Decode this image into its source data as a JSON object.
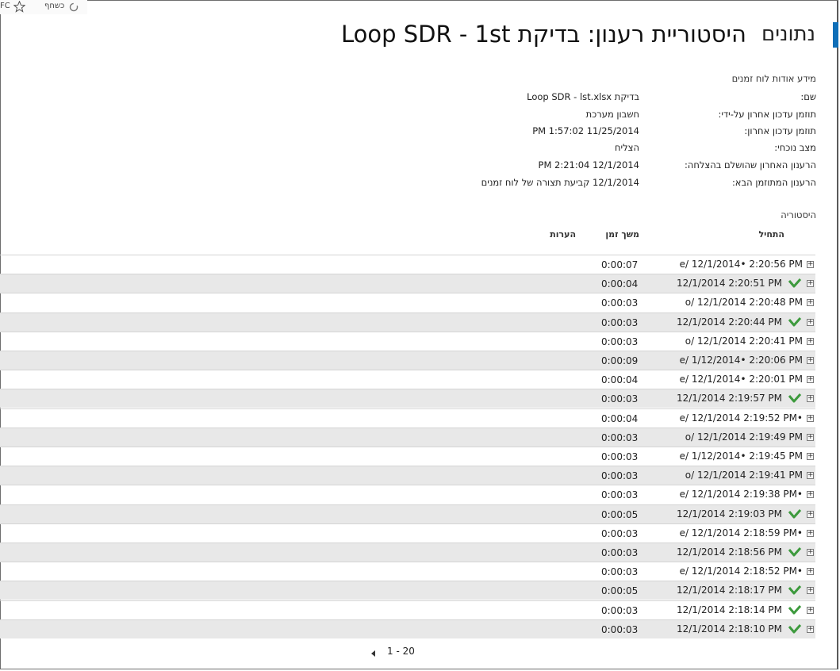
{
  "browser": {
    "share_label": "כשחף",
    "fav_label": "FC"
  },
  "page": {
    "app_title": "נתונים",
    "title": "היסטוריית רענון: בדיקת Loop SDR - 1st"
  },
  "info": {
    "section_title": "מידע אודות לוח זמנים",
    "fields": [
      {
        "label": "שם:",
        "value": "בדיקת Loop SDR - lst.xlsx"
      },
      {
        "label": "תוזמן עדכון אחרון על-ידי:",
        "value": "חשבון מערכת"
      },
      {
        "label": "תוזמן עדכון אחרון:",
        "value": "11/25/2014 1:57:02 PM"
      },
      {
        "label": "מצב נוכחי:",
        "value": "הצליח"
      },
      {
        "label": "הרענון האחרון שהושלם בהצלחה:",
        "value": "12/1/2014 2:21:04 PM"
      },
      {
        "label": "הרענון המתוזמן הבא:",
        "value": "12/1/2014   קביעת תצורה של לוח זמנים"
      }
    ]
  },
  "history": {
    "section_title": "היסטוריה",
    "columns": {
      "started": "התחיל",
      "duration": "משך זמן",
      "comments": "הערות"
    },
    "rows": [
      {
        "started": "e/ 12/1/2014•   2:20:56 PM",
        "duration": "0:00:07",
        "ok": false
      },
      {
        "started": "12/1/2014 2:20:51 PM",
        "duration": "0:00:04",
        "ok": true
      },
      {
        "started": "o/ 12/1/2014   2:20:48 PM",
        "duration": "0:00:03",
        "ok": false
      },
      {
        "started": "12/1/2014 2:20:44 PM",
        "duration": "0:00:03",
        "ok": true
      },
      {
        "started": "o/ 12/1/2014   2:20:41 PM",
        "duration": "0:00:03",
        "ok": false
      },
      {
        "started": "e/ 1/12/2014•   2:20:06 PM",
        "duration": "0:00:09",
        "ok": false
      },
      {
        "started": "e/ 12/1/2014•   2:20:01 PM",
        "duration": "0:00:04",
        "ok": false
      },
      {
        "started": "12/1/2014 2:19:57 PM",
        "duration": "0:00:03",
        "ok": true
      },
      {
        "started": "e/ 12/1/2014 2:19:52 PM•",
        "duration": "0:00:04",
        "ok": false
      },
      {
        "started": "o/ 12/1/2014   2:19:49 PM",
        "duration": "0:00:03",
        "ok": false
      },
      {
        "started": "e/ 1/12/2014•   2:19:45 PM",
        "duration": "0:00:03",
        "ok": false
      },
      {
        "started": "o/ 12/1/2014   2:19:41 PM",
        "duration": "0:00:03",
        "ok": false
      },
      {
        "started": "e/ 12/1/2014 2:19:38 PM•",
        "duration": "0:00:03",
        "ok": false
      },
      {
        "started": "12/1/2014 2:19:03 PM",
        "duration": "0:00:05",
        "ok": true
      },
      {
        "started": "e/ 12/1/2014 2:18:59 PM•",
        "duration": "0:00:03",
        "ok": false
      },
      {
        "started": "12/1/2014 2:18:56 PM",
        "duration": "0:00:03",
        "ok": true
      },
      {
        "started": "e/ 12/1/2014 2:18:52 PM•",
        "duration": "0:00:03",
        "ok": false
      },
      {
        "started": "12/1/2014 2:18:17 PM",
        "duration": "0:00:05",
        "ok": true
      },
      {
        "started": "12/1/2014 2:18:14 PM",
        "duration": "0:00:03",
        "ok": true
      },
      {
        "started": "12/1/2014 2:18:10 PM",
        "duration": "0:00:03",
        "ok": true
      }
    ]
  },
  "pager": {
    "range": "1 - 20"
  },
  "icons": {
    "check_color": "#3d9a3d",
    "accent_color": "#0f6fb8"
  }
}
